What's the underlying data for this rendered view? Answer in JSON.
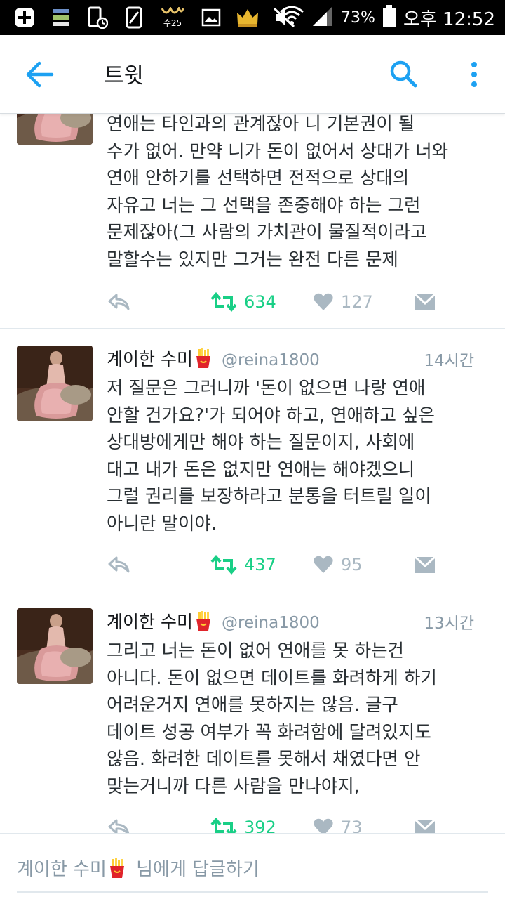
{
  "status_bar": {
    "battery_percent": "73%",
    "time": "오후 12:52",
    "uv_label": "수25",
    "icons": [
      "add-box-icon",
      "stack-icon",
      "phone-clock-icon",
      "phone-no-sim-icon",
      "uv-index-icon",
      "image-icon",
      "crown-icon",
      "mute-icon",
      "wifi-icon",
      "signal-icon",
      "battery-icon"
    ]
  },
  "app_bar": {
    "title": "트윗",
    "icons": [
      "back-arrow-icon",
      "search-icon",
      "more-vert-icon"
    ]
  },
  "colors": {
    "accent": "#1da1f2",
    "retweet": "#19cf86",
    "muted": "#aab8c2",
    "text": "#292f33"
  },
  "tweets": [
    {
      "lines": [
        "연애는 타인과의 관계잖아 니 기본권이 될",
        "수가 없어. 만약 니가 돈이 없어서 상대가 너와",
        "연애 안하기를 선택하면 전적으로 상대의",
        "자유고 너는 그 선택을 존중해야 하는 그런",
        "문제잖아(그 사람의 가치관이 물질적이라고",
        "말할수는 있지만 그거는 완전 다른 문제"
      ],
      "retweets": "634",
      "likes": "127"
    },
    {
      "name": "계이한 수미",
      "emoji": "fries-icon",
      "handle": "@reina1800",
      "time": "14시간",
      "lines": [
        "저 질문은 그러니까 '돈이 없으면 나랑 연애",
        "안할 건가요?'가 되어야 하고, 연애하고 싶은",
        "상대방에게만 해야 하는 질문이지, 사회에",
        "대고 내가 돈은 없지만 연애는 해야겠으니",
        "그럴 권리를 보장하라고 분통을 터트릴 일이",
        "아니란 말이야."
      ],
      "retweets": "437",
      "likes": "95"
    },
    {
      "name": "계이한 수미",
      "emoji": "fries-icon",
      "handle": "@reina1800",
      "time": "13시간",
      "lines": [
        "그리고 너는 돈이 없어 연애를 못 하는건",
        "아니다. 돈이 없으면 데이트를 화려하게 하기",
        "어려운거지 연애를 못하지는 않음. 글구",
        "데이트 성공 여부가 꼭 화려함에 달려있지도",
        "않음. 화려한 데이트를 못해서 채였다면 안",
        "맞는거니까 다른 사람을 만나야지,"
      ],
      "retweets": "392",
      "likes": "73"
    }
  ],
  "reply_bar": {
    "name": "계이한 수미",
    "emoji": "fries-icon",
    "suffix": "님에게 답글하기"
  }
}
